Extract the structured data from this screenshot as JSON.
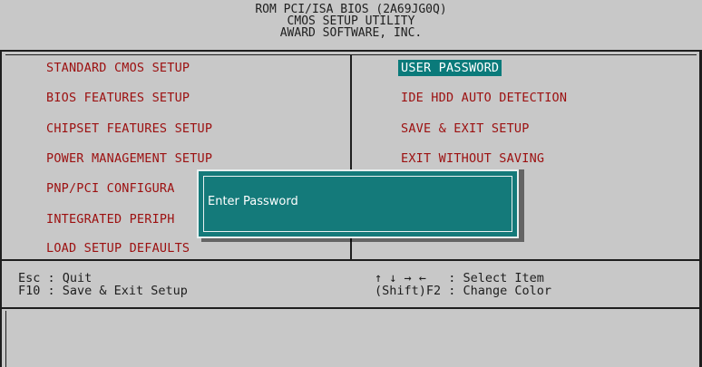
{
  "header": {
    "line1": "ROM PCI/ISA BIOS (2A69JG0Q)",
    "line2": "CMOS SETUP UTILITY",
    "line3": "AWARD SOFTWARE, INC."
  },
  "menu_left": [
    "STANDARD CMOS SETUP",
    "BIOS FEATURES SETUP",
    "CHIPSET FEATURES SETUP",
    "POWER MANAGEMENT SETUP",
    "PNP/PCI CONFIGURA",
    "INTEGRATED PERIPH",
    "LOAD SETUP DEFAULTS"
  ],
  "menu_right": [
    "USER PASSWORD",
    "IDE HDD AUTO DETECTION",
    "SAVE & EXIT SETUP",
    "EXIT WITHOUT SAVING"
  ],
  "footer": {
    "left1": "Esc : Quit",
    "left2": "F10 : Save & Exit Setup",
    "right1": "↑ ↓ → ←   : Select Item",
    "right2": "(Shift)F2 : Change Color"
  },
  "dialog": {
    "prompt": "Enter Password"
  },
  "colors": {
    "background": "#c8c8c8",
    "menu_text": "#9c1010",
    "highlight": "#0a7a7a",
    "dialog_bg": "#147a7a"
  }
}
